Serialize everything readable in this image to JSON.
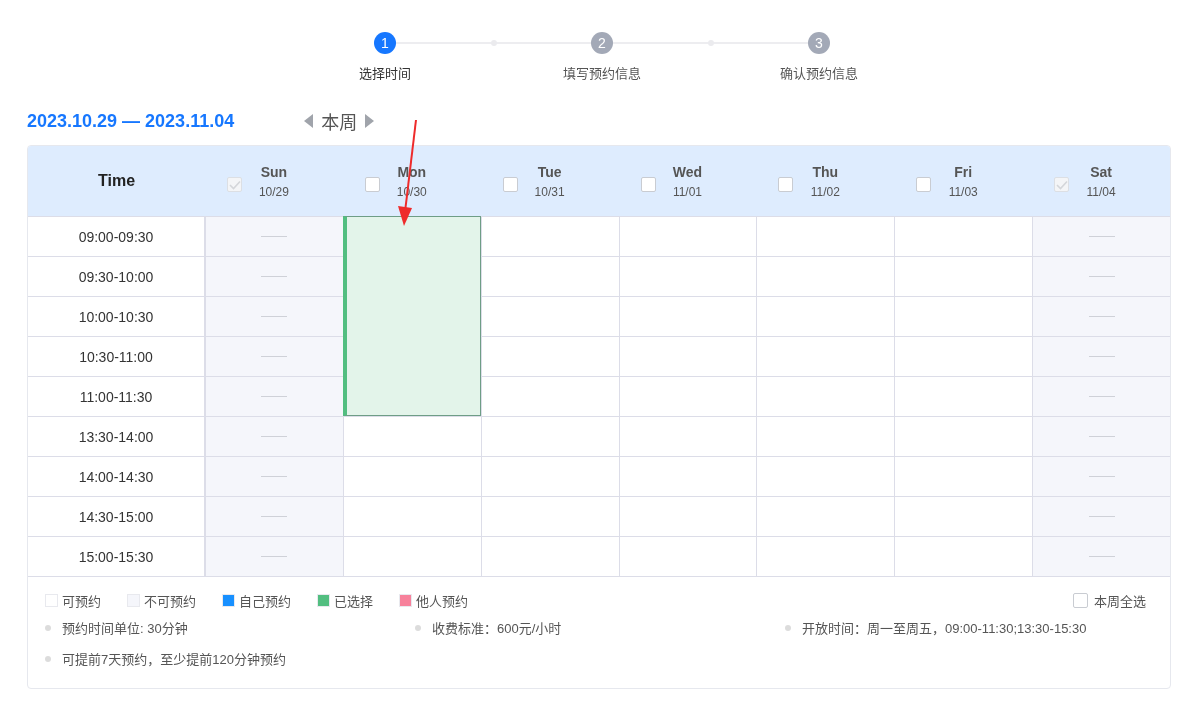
{
  "steps": [
    {
      "number": "1",
      "label": "选择时间",
      "selected": true
    },
    {
      "number": "2",
      "label": "填写预约信息",
      "selected": false
    },
    {
      "number": "3",
      "label": "确认预约信息",
      "selected": false
    }
  ],
  "week": {
    "range": "2023.10.29 — 2023.11.04",
    "nav_label": "本周"
  },
  "table": {
    "time_heading": "Time",
    "days": [
      {
        "name": "Sun",
        "date": "10/29",
        "checked": true,
        "disabled": true,
        "slots": [
          {
            "kind": "unavailable"
          },
          {
            "kind": "unavailable"
          },
          {
            "kind": "unavailable"
          },
          {
            "kind": "unavailable"
          },
          {
            "kind": "unavailable"
          },
          {
            "kind": "unavailable"
          },
          {
            "kind": "unavailable"
          },
          {
            "kind": "unavailable"
          },
          {
            "kind": "unavailable"
          }
        ]
      },
      {
        "name": "Mon",
        "date": "10/30",
        "checked": false,
        "disabled": false,
        "slots": [
          {
            "kind": "selected"
          },
          {
            "kind": "selected"
          },
          {
            "kind": "selected"
          },
          {
            "kind": "selected"
          },
          {
            "kind": "selected"
          },
          {
            "kind": "available"
          },
          {
            "kind": "available"
          },
          {
            "kind": "available"
          },
          {
            "kind": "available"
          }
        ]
      },
      {
        "name": "Tue",
        "date": "10/31",
        "checked": false,
        "disabled": false,
        "slots": [
          {
            "kind": "available"
          },
          {
            "kind": "available"
          },
          {
            "kind": "available"
          },
          {
            "kind": "available"
          },
          {
            "kind": "available"
          },
          {
            "kind": "available"
          },
          {
            "kind": "available"
          },
          {
            "kind": "available"
          },
          {
            "kind": "available"
          }
        ]
      },
      {
        "name": "Wed",
        "date": "11/01",
        "checked": false,
        "disabled": false,
        "slots": [
          {
            "kind": "available"
          },
          {
            "kind": "available"
          },
          {
            "kind": "available"
          },
          {
            "kind": "available"
          },
          {
            "kind": "available"
          },
          {
            "kind": "available"
          },
          {
            "kind": "available"
          },
          {
            "kind": "available"
          },
          {
            "kind": "available"
          }
        ]
      },
      {
        "name": "Thu",
        "date": "11/02",
        "checked": false,
        "disabled": false,
        "slots": [
          {
            "kind": "available"
          },
          {
            "kind": "available"
          },
          {
            "kind": "available"
          },
          {
            "kind": "available"
          },
          {
            "kind": "available"
          },
          {
            "kind": "available"
          },
          {
            "kind": "available"
          },
          {
            "kind": "available"
          },
          {
            "kind": "available"
          }
        ]
      },
      {
        "name": "Fri",
        "date": "11/03",
        "checked": false,
        "disabled": false,
        "slots": [
          {
            "kind": "available"
          },
          {
            "kind": "available"
          },
          {
            "kind": "available"
          },
          {
            "kind": "available"
          },
          {
            "kind": "available"
          },
          {
            "kind": "available"
          },
          {
            "kind": "available"
          },
          {
            "kind": "available"
          },
          {
            "kind": "available"
          }
        ]
      },
      {
        "name": "Sat",
        "date": "11/04",
        "checked": true,
        "disabled": true,
        "slots": [
          {
            "kind": "unavailable"
          },
          {
            "kind": "unavailable"
          },
          {
            "kind": "unavailable"
          },
          {
            "kind": "unavailable"
          },
          {
            "kind": "unavailable"
          },
          {
            "kind": "unavailable"
          },
          {
            "kind": "unavailable"
          },
          {
            "kind": "unavailable"
          },
          {
            "kind": "unavailable"
          }
        ]
      }
    ],
    "times": [
      "09:00-09:30",
      "09:30-10:00",
      "10:00-10:30",
      "10:30-11:00",
      "11:00-11:30",
      "13:30-14:00",
      "14:00-14:30",
      "14:30-15:00",
      "15:00-15:30"
    ]
  },
  "legend": [
    {
      "label": "可预约",
      "color": "#ffffff"
    },
    {
      "label": "不可预约",
      "color": "#f5f6fb"
    },
    {
      "label": "自己预约",
      "color": "#1890ff"
    },
    {
      "label": "已选择",
      "color": "#52be80"
    },
    {
      "label": "他人预约",
      "color": "#f7819b"
    }
  ],
  "select_all": {
    "label": "本周全选",
    "checked": false
  },
  "notes": [
    "预约时间单位: 30分钟",
    "收费标准：600元/小时",
    "开放时间：周一至周五，09:00-11:30;13:30-15:30",
    "可提前7天预约，至少提前120分钟预约"
  ]
}
